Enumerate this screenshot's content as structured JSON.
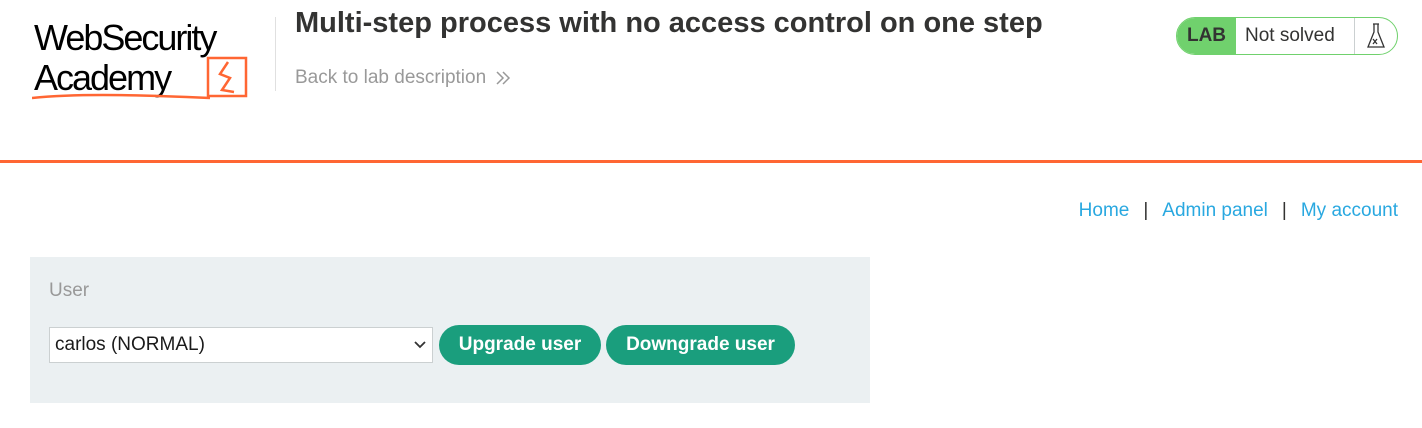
{
  "header": {
    "logo_line1": "WebSecurity",
    "logo_line2": "Academy",
    "lab_title": "Multi-step process with no access control on one step",
    "back_link": "Back to lab description",
    "status_badge": "LAB",
    "status_text": "Not solved"
  },
  "nav": {
    "items": [
      {
        "label": "Home"
      },
      {
        "label": "Admin panel"
      },
      {
        "label": "My account"
      }
    ],
    "separator": "|"
  },
  "admin": {
    "field_label": "User",
    "selected_user": "carlos (NORMAL)",
    "upgrade_label": "Upgrade user",
    "downgrade_label": "Downgrade user"
  },
  "colors": {
    "accent_orange": "#ff6633",
    "lab_green": "#70d16d",
    "button_green": "#1a9e7d",
    "link_blue": "#29a8e0",
    "panel_bg": "#ebf0f2"
  },
  "icons": [
    "academy-logo",
    "double-chevron-right-icon",
    "flask-icon",
    "chevron-down-icon"
  ]
}
